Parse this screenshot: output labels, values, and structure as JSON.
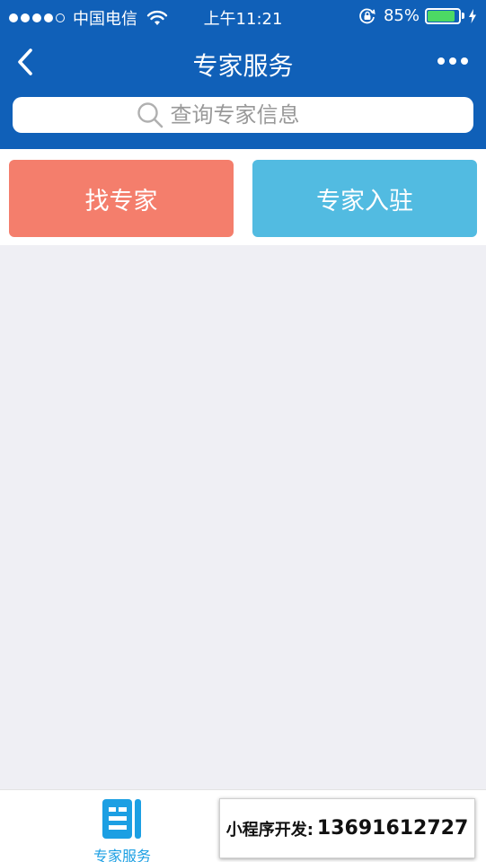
{
  "status_bar": {
    "carrier": "中国电信",
    "time": "上午11:21",
    "battery_percent": "85%",
    "battery_level": 0.85,
    "signal_bars": 4,
    "icons": [
      "signal-dots",
      "wifi-icon",
      "rotation-lock-icon",
      "battery-icon",
      "charging-bolt-icon"
    ]
  },
  "header": {
    "title": "专家服务",
    "back_icon": "chevron-left-icon",
    "more_icon": "more-dots-icon"
  },
  "search": {
    "placeholder": "查询专家信息",
    "icon": "search-icon"
  },
  "actions": {
    "find_expert": "找专家",
    "expert_join": "专家入驻"
  },
  "tab_bar": {
    "tabs": [
      {
        "label": "专家服务",
        "icon": "document-list-icon",
        "active": true
      },
      {
        "label": "",
        "icon": "avatar-icon",
        "active": false
      }
    ]
  },
  "promo": {
    "label": "小程序开发:",
    "number": "13691612727"
  },
  "colors": {
    "brand_blue": "#1060b8",
    "find_button": "#f47e6c",
    "join_button": "#52bbe1",
    "tab_active": "#1c9fe3",
    "page_bg": "#efeff4"
  }
}
